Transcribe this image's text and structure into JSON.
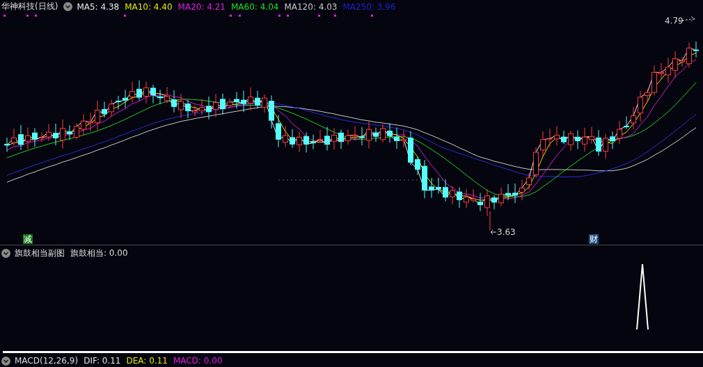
{
  "main_panel": {
    "title": "华神科技(日线)",
    "indicators": [
      {
        "label": "MA5: 4.38",
        "color": "#e6e6e6"
      },
      {
        "label": "MA10: 4.40",
        "color": "#e8e800"
      },
      {
        "label": "MA20: 4.21",
        "color": "#e020e0"
      },
      {
        "label": "MA60: 4.04",
        "color": "#20e020"
      },
      {
        "label": "MA120: 4.03",
        "color": "#c8c8c8"
      },
      {
        "label": "MA250: 3.96",
        "color": "#2020d0"
      }
    ],
    "high_label": "4.79",
    "low_label": "3.63",
    "markers": [
      {
        "text": "减",
        "color": "#1a7a1a"
      },
      {
        "text": "财",
        "color": "#1f4f7f"
      }
    ]
  },
  "sub_panel": {
    "title": "旗鼓相当副图",
    "indicators": [
      {
        "label": "旗鼓相当: 0.00",
        "color": "#dcdcdc"
      }
    ]
  },
  "macd_panel": {
    "title": "MACD(12,26,9)",
    "indicators": [
      {
        "label": "DIF: 0.11",
        "color": "#e6e6e6"
      },
      {
        "label": "DEA: 0.11",
        "color": "#e8e800"
      },
      {
        "label": "MACD: 0.00",
        "color": "#e020e0"
      }
    ]
  }
}
